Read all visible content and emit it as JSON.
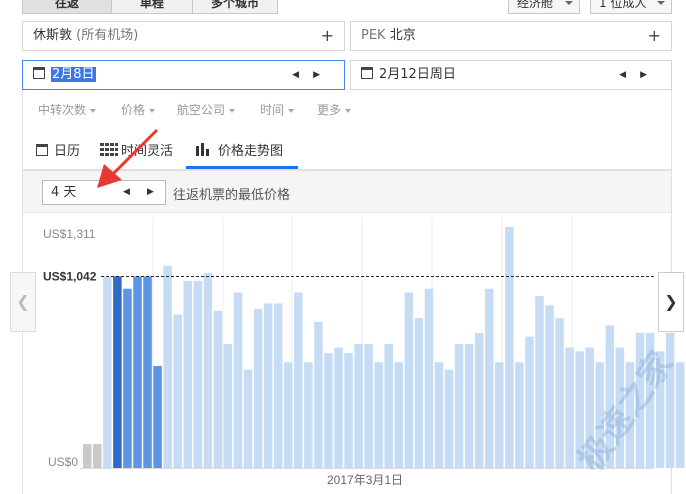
{
  "trip_tabs": [
    "往返",
    "单程",
    "多个城市"
  ],
  "cabin_class": "经济舱",
  "passengers": "1 位成人",
  "origin": {
    "city": "休斯敦",
    "detail": "(所有机场)"
  },
  "destination": {
    "code": "PEK",
    "city": "北京"
  },
  "depart_date": "2月8日",
  "return_date": "2月12日周日",
  "filters": [
    "中转次数",
    "价格",
    "航空公司",
    "时间",
    "更多"
  ],
  "view_tabs": [
    "日历",
    "时间灵活",
    "价格走势图"
  ],
  "trip_length": "4 天",
  "chart_caption": "往返机票的最低价格",
  "colors": {
    "accent": "#1a73e8",
    "bar_light": "#c5dcf4",
    "bar_mid": "#5b95e3",
    "bar_dark": "#2f6ac4",
    "bar_grey": "#c9c9c9"
  },
  "chart_data": {
    "type": "bar",
    "yticks": [
      "US$1,311",
      "US$0"
    ],
    "reference_label": "US$1,042",
    "reference_value": 1042,
    "x_label": "2017年3月1日",
    "ylim": [
      0,
      1311
    ],
    "values": [
      130,
      130,
      1042,
      1042,
      975,
      1042,
      1042,
      555,
      1100,
      835,
      1018,
      1018,
      1060,
      855,
      675,
      955,
      535,
      865,
      895,
      895,
      575,
      955,
      575,
      795,
      625,
      655,
      625,
      675,
      675,
      575,
      675,
      575,
      955,
      815,
      975,
      575,
      535,
      675,
      675,
      735,
      975,
      575,
      1311,
      575,
      715,
      935,
      885,
      815,
      655,
      635,
      655,
      575,
      775,
      655,
      575,
      735,
      735,
      635,
      735,
      575,
      875,
      575,
      895,
      805,
      915,
      755
    ],
    "value_colors": [
      "grey",
      "grey",
      "light",
      "dark",
      "mid",
      "mid",
      "mid",
      "mid",
      "light",
      "light",
      "light",
      "light",
      "light",
      "light",
      "light",
      "light",
      "light",
      "light",
      "light",
      "light",
      "light",
      "light",
      "light",
      "light",
      "light",
      "light",
      "light",
      "light",
      "light",
      "light",
      "light",
      "light",
      "light",
      "light",
      "light",
      "light",
      "light",
      "light",
      "light",
      "light",
      "light",
      "light",
      "light",
      "light",
      "light",
      "light",
      "light",
      "light",
      "light",
      "light",
      "light",
      "light",
      "light",
      "light",
      "light",
      "light",
      "light",
      "light",
      "light",
      "light",
      "light",
      "light",
      "light",
      "light",
      "light",
      "light"
    ]
  },
  "watermark": "极速之家"
}
